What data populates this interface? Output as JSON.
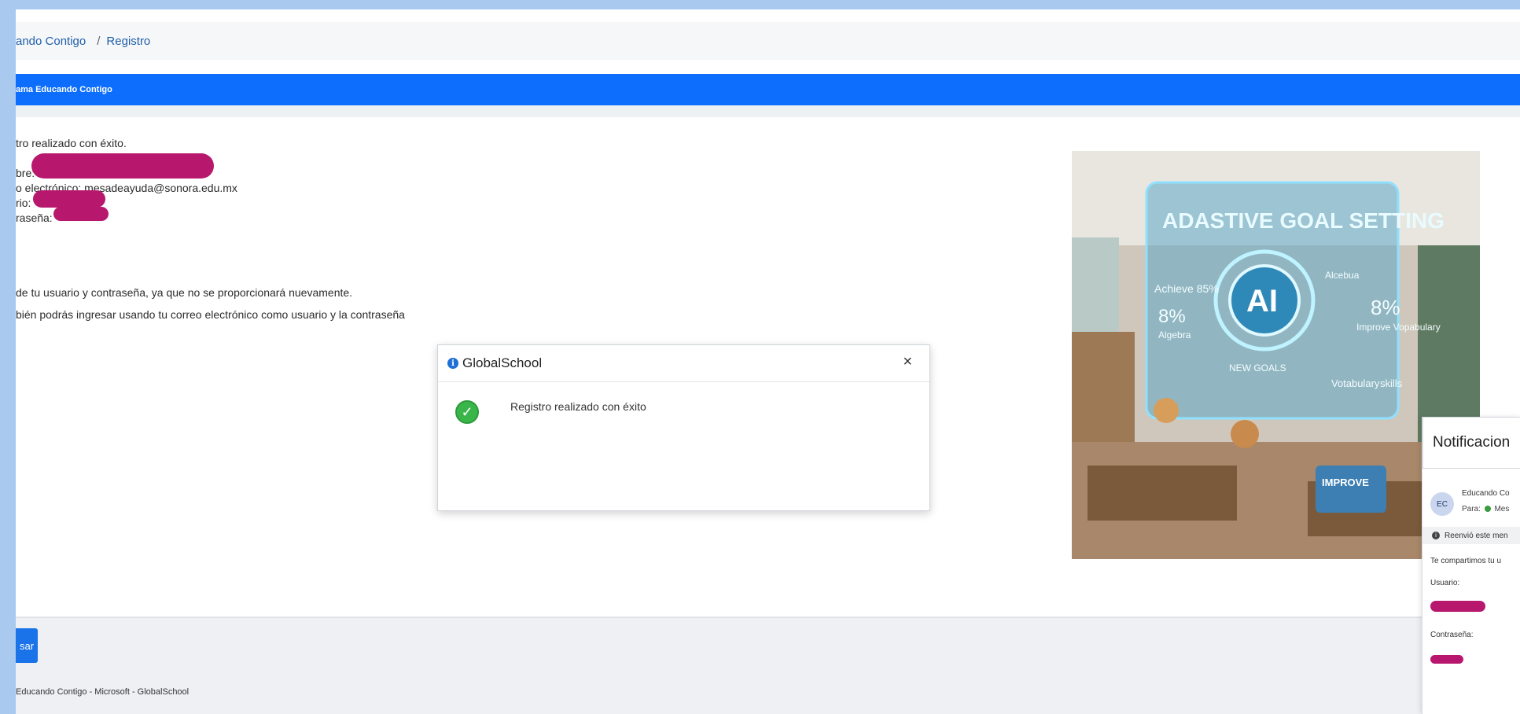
{
  "breadcrumb": {
    "home": "ando Contigo",
    "separator": "/",
    "current": "Registro"
  },
  "program_bar": {
    "label": "ama Educando Contigo"
  },
  "content": {
    "success_line": "tro realizado con éxito.",
    "name_label": "bre:",
    "email_line": "o electrónico: mesadeayuda@sonora.edu.mx",
    "user_label": "rio:",
    "password_label": "raseña:",
    "keep_line": "de tu usuario y contraseña, ya que no se proporcionará nuevamente.",
    "also_line": "bién podrás ingresar usando tu correo electrónico como usuario y la contraseña"
  },
  "image": {
    "alt_caption": "ADASTIVE GOAL SETTING",
    "labels": [
      "AI",
      "Achieve 85%",
      "8%",
      "Algebra",
      "Alcebua",
      "8%",
      "Improve Vopabulary",
      "NEW GOALS",
      "Votabulary",
      "skills",
      "IMPROVE"
    ]
  },
  "footer": {
    "button_label": "sar",
    "credits": "Educando Contigo - Microsoft - GlobalSchool"
  },
  "modal": {
    "title": "GlobalSchool",
    "close": "×",
    "message": "Registro realizado con éxito"
  },
  "notification": {
    "header": "Notificacion",
    "avatar": "EC",
    "sender": "Educando Co",
    "to_label": "Para:",
    "to_value": "Mes",
    "forwarded": "Reenvió este men",
    "intro": "Te compartimos tu u",
    "user_label": "Usuario:",
    "password_label": "Contraseña:"
  },
  "colors": {
    "accent": "#0d6efd",
    "redaction": "#b8176e",
    "success": "#3ab54a"
  }
}
